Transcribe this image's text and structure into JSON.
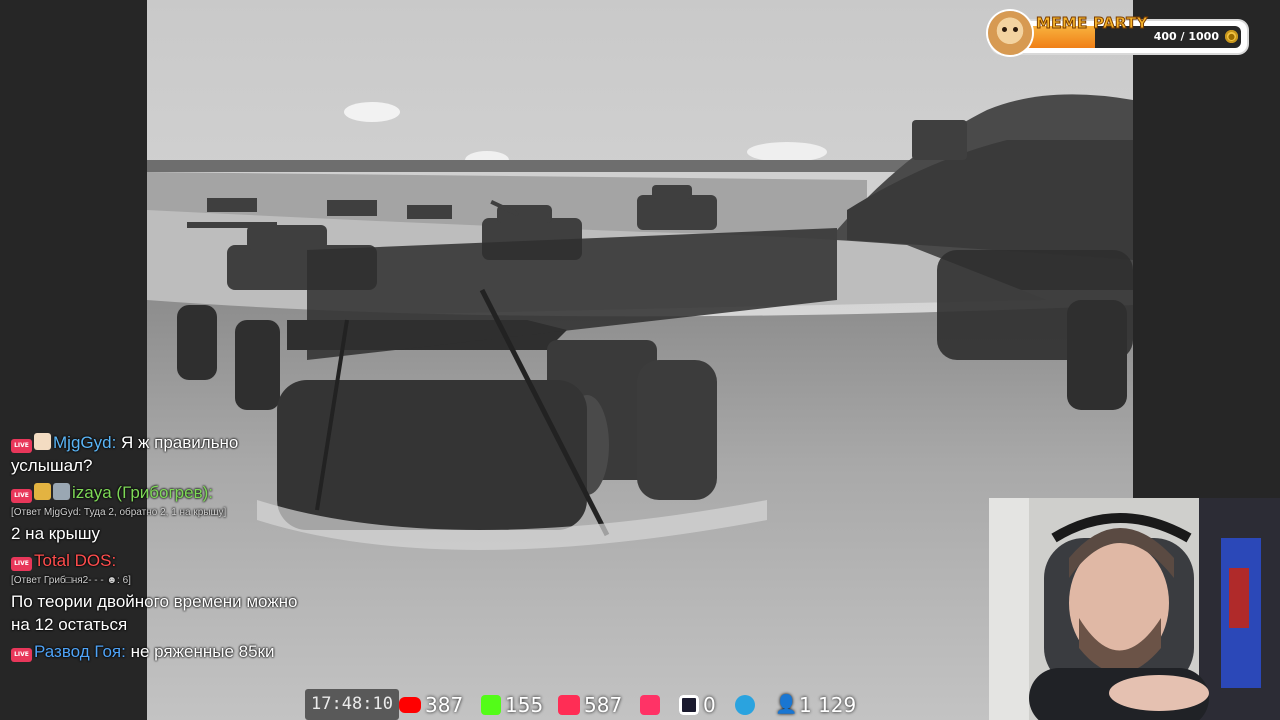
{
  "meme_party": {
    "title": "MEME PARTY",
    "progress_text": "400 / 1000",
    "progress_fraction": 0.4,
    "colors": {
      "fill": "#f39022",
      "title": "#f7b52c"
    },
    "icons": [
      "doge-icon",
      "coin-icon"
    ]
  },
  "chat": {
    "messages": [
      {
        "badges": [
          "live-badge",
          "scroll-badge"
        ],
        "username": "MjgGyd:",
        "username_color": "#5ab4f5",
        "reply": "",
        "text": "Я ж правильно услышал?"
      },
      {
        "badges": [
          "live-badge",
          "trophy-badge",
          "face-badge"
        ],
        "username": "izaya (Грибогрев):",
        "username_color": "#7ed957",
        "reply": "[Ответ MjgGyd: Туда 2, обратно 2, 1 на крышу]",
        "text": "2 на крышу"
      },
      {
        "badges": [
          "live-badge"
        ],
        "username": "Total DOS:",
        "username_color": "#ff4d4d",
        "reply": "[Ответ Гриб□ня2- - - ☻: 6]",
        "text": "По теории двойного времени можно на 12 остаться"
      },
      {
        "badges": [
          "live-badge"
        ],
        "username": "Развод Гоя:",
        "username_color": "#4fa3f7",
        "reply": "",
        "text": "не ряженные 85ки"
      }
    ]
  },
  "stats": {
    "clock": "17:48:10",
    "youtube": "387",
    "kick": "155",
    "vklive": "587",
    "vkvideo": "",
    "rutube": "0",
    "telegram": "",
    "viewers": "1 129",
    "colors": {
      "youtube": "#ff0000",
      "kick": "#53fc18",
      "vklive": "#ff2d55",
      "vkvideo": "#ff3366",
      "rutube": "#1a1a2e",
      "telegram": "#2aa3df",
      "viewers": "#3b8ed8"
    }
  }
}
